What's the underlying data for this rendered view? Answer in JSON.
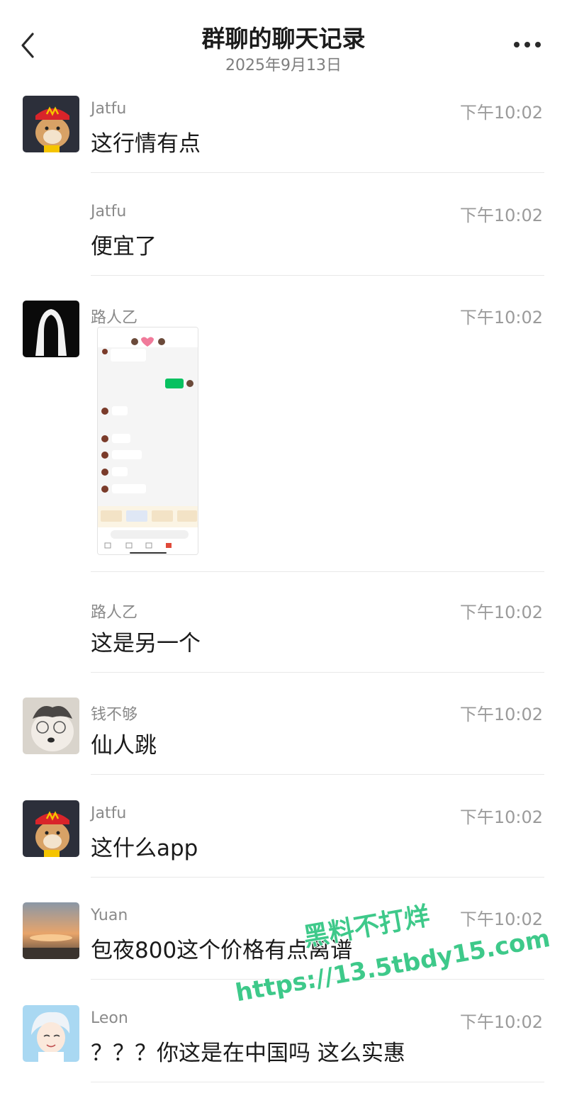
{
  "header": {
    "title": "群聊的聊天记录",
    "date": "2025年9月13日"
  },
  "messages": [
    {
      "sender": "Jatfu",
      "time": "下午10:02",
      "text": "这行情有点"
    },
    {
      "sender": "Jatfu",
      "time": "下午10:02",
      "text": "便宜了"
    },
    {
      "sender": "路人乙",
      "time": "下午10:02",
      "text": ""
    },
    {
      "sender": "路人乙",
      "time": "下午10:02",
      "text": "这是另一个"
    },
    {
      "sender": "钱不够",
      "time": "下午10:02",
      "text": "仙人跳"
    },
    {
      "sender": "Jatfu",
      "time": "下午10:02",
      "text": "这什么app"
    },
    {
      "sender": "Yuan",
      "time": "下午10:02",
      "text": "包夜800这个价格有点离谱"
    },
    {
      "sender": "Leon",
      "time": "下午10:02",
      "text": "？？？你这是在中国吗  这么实惠"
    }
  ],
  "watermark": {
    "line1": "黑料不打烊",
    "line2": "https://13.5tbdy15.com"
  },
  "colors": {
    "accent_green": "#07c160",
    "watermark_green": "#3ec98a"
  }
}
